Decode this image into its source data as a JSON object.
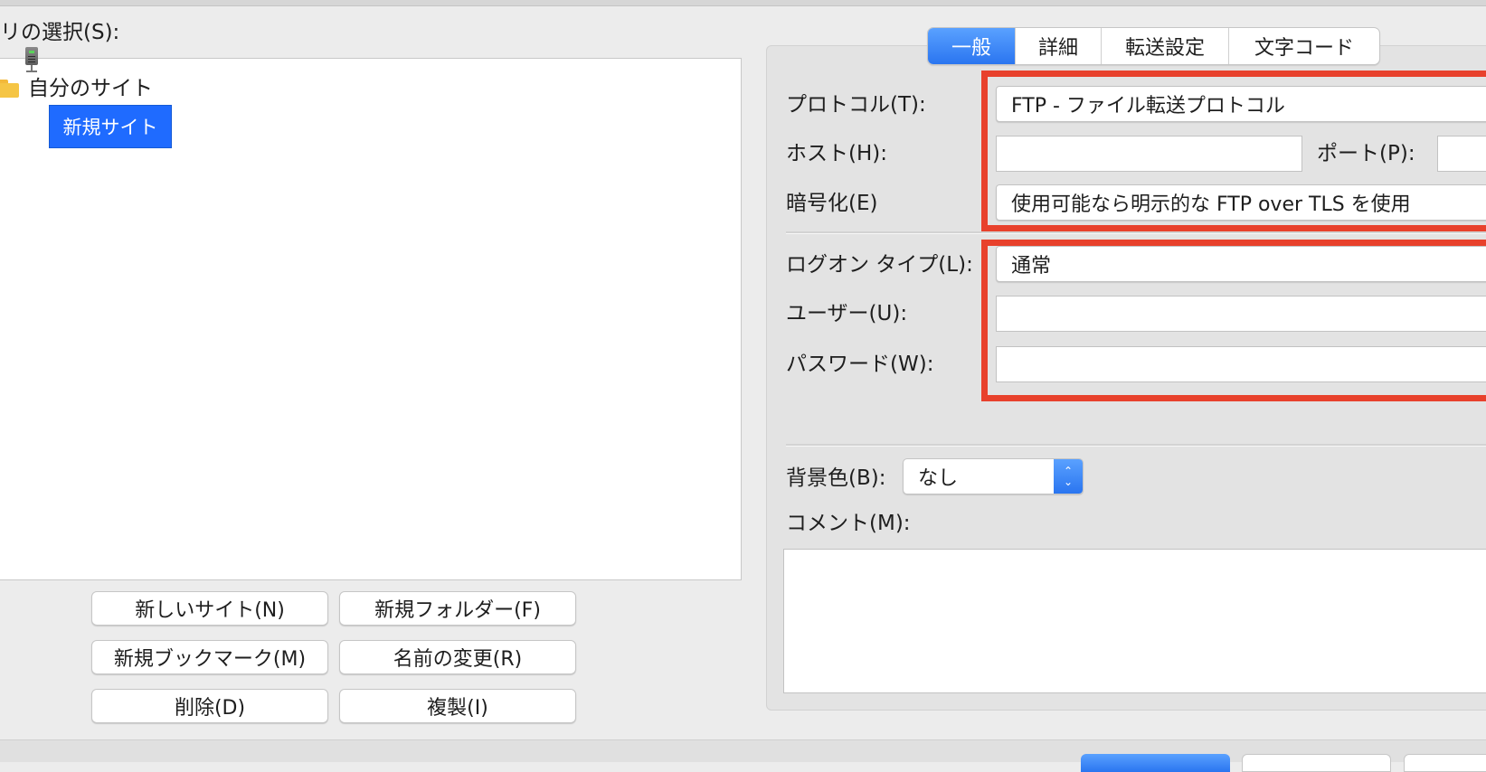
{
  "site_tree": {
    "label": "リの選択(S):",
    "folder_label": "自分のサイト",
    "selected_site": "新規サイト"
  },
  "site_buttons": {
    "new_site": "新しいサイト(N)",
    "new_folder": "新規フォルダー(F)",
    "new_bookmark": "新規ブックマーク(M)",
    "rename": "名前の変更(R)",
    "delete": "削除(D)",
    "duplicate": "複製(I)"
  },
  "tabs": [
    {
      "label": "一般",
      "active": true
    },
    {
      "label": "詳細",
      "active": false
    },
    {
      "label": "転送設定",
      "active": false
    },
    {
      "label": "文字コード",
      "active": false
    }
  ],
  "general": {
    "protocol_label": "プロトコル(T):",
    "protocol_value": "FTP - ファイル転送プロトコル",
    "host_label": "ホスト(H):",
    "host_value": "",
    "port_label": "ポート(P):",
    "port_value": "",
    "encryption_label": "暗号化(E)",
    "encryption_value": "使用可能なら明示的な FTP over TLS を使用",
    "logon_type_label": "ログオン タイプ(L):",
    "logon_type_value": "通常",
    "user_label": "ユーザー(U):",
    "user_value": "",
    "password_label": "パスワード(W):",
    "password_value": "",
    "bg_color_label": "背景色(B):",
    "bg_color_value": "なし",
    "comment_label": "コメント(M):",
    "comment_value": ""
  },
  "colors": {
    "accent": "#2a75f0",
    "selection": "#1f6bff",
    "highlight_box": "#e8412c"
  }
}
